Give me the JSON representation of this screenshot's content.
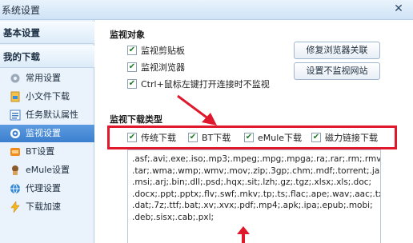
{
  "window": {
    "title": "系统设置"
  },
  "sidebar": {
    "sections": [
      {
        "label": "基本设置"
      },
      {
        "label": "我的下载"
      }
    ],
    "items": [
      {
        "label": "常用设置",
        "icon": "gear-icon"
      },
      {
        "label": "小文件下载",
        "icon": "file-icon"
      },
      {
        "label": "任务默认属性",
        "icon": "properties-icon"
      },
      {
        "label": "监视设置",
        "icon": "monitor-icon",
        "active": true
      },
      {
        "label": "BT设置",
        "icon": "bt-icon"
      },
      {
        "label": "eMule设置",
        "icon": "emule-icon"
      },
      {
        "label": "代理设置",
        "icon": "proxy-icon"
      },
      {
        "label": "下载加速",
        "icon": "lightning-icon"
      }
    ]
  },
  "monitor": {
    "heading": "监视对象",
    "options": [
      {
        "label": "监视剪贴板",
        "checked": true
      },
      {
        "label": "监视浏览器",
        "checked": true
      },
      {
        "label": "Ctrl+鼠标左键打开连接时不监视",
        "checked": true
      }
    ],
    "buttons": {
      "repair": "修复浏览器关联",
      "exclude": "设置不监视网站"
    }
  },
  "types": {
    "heading": "监视下载类型",
    "options": [
      {
        "label": "传统下载",
        "checked": true
      },
      {
        "label": "BT下载",
        "checked": true
      },
      {
        "label": "eMule下载",
        "checked": true
      },
      {
        "label": "磁力链接下载",
        "checked": true
      }
    ],
    "extensions": [
      ".asf;.avi;.exe;.iso;.mp3;.mpeg;.mpg;.mpga;.ra;.rar;.rm;.rmvb;",
      ".tar;.wma;.wmp;.wmv;.mov;.zip;.3gp;.chm;.mdf;.torrent;.jar;",
      ".msi;.arj;.bin;.dll;.psd;.hqx;.sit;.lzh;.gz;.tgz;.xlsx;.xls;.doc;",
      ".docx;.ppt;.pptx;.flv;.swf;.mkv;.tp;.ts;.flac;.ape;.wav;.aac;.txt;",
      ".dat;.7z;.ttf;.bat;.xv;.xvx;.pdf;.mp4;.apk;.ipa;.epub;.mobi;",
      ".deb;.sisx;.cab;.pxl;"
    ]
  },
  "annotation": {
    "highlight_color": "#e0182b"
  }
}
